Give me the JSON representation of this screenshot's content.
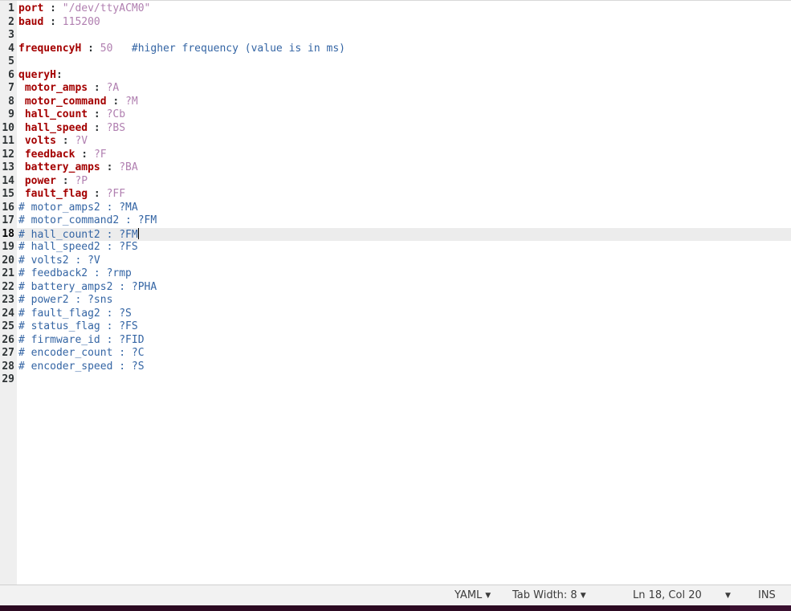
{
  "editor": {
    "current_line": 18,
    "lines": [
      {
        "n": "1",
        "segs": [
          {
            "t": "port",
            "c": "k"
          },
          {
            "t": " : ",
            "c": "p"
          },
          {
            "t": "\"/dev/ttyACM0\"",
            "c": "v"
          }
        ]
      },
      {
        "n": "2",
        "segs": [
          {
            "t": "baud",
            "c": "k"
          },
          {
            "t": " : ",
            "c": "p"
          },
          {
            "t": "115200",
            "c": "v"
          }
        ]
      },
      {
        "n": "3",
        "segs": []
      },
      {
        "n": "4",
        "segs": [
          {
            "t": "frequencyH",
            "c": "k"
          },
          {
            "t": " : ",
            "c": "p"
          },
          {
            "t": "50",
            "c": "v"
          },
          {
            "t": "   #higher frequency (value is in ms)",
            "c": "c"
          }
        ]
      },
      {
        "n": "5",
        "segs": []
      },
      {
        "n": "6",
        "segs": [
          {
            "t": "queryH",
            "c": "k"
          },
          {
            "t": ":",
            "c": "p"
          }
        ]
      },
      {
        "n": "7",
        "segs": [
          {
            "t": " ",
            "c": "p"
          },
          {
            "t": "motor_amps",
            "c": "k"
          },
          {
            "t": " : ",
            "c": "p"
          },
          {
            "t": "?A",
            "c": "v"
          }
        ]
      },
      {
        "n": "8",
        "segs": [
          {
            "t": " ",
            "c": "p"
          },
          {
            "t": "motor_command",
            "c": "k"
          },
          {
            "t": " : ",
            "c": "p"
          },
          {
            "t": "?M",
            "c": "v"
          }
        ]
      },
      {
        "n": "9",
        "segs": [
          {
            "t": " ",
            "c": "p"
          },
          {
            "t": "hall_count",
            "c": "k"
          },
          {
            "t": " : ",
            "c": "p"
          },
          {
            "t": "?Cb",
            "c": "v"
          }
        ]
      },
      {
        "n": "10",
        "segs": [
          {
            "t": " ",
            "c": "p"
          },
          {
            "t": "hall_speed",
            "c": "k"
          },
          {
            "t": " : ",
            "c": "p"
          },
          {
            "t": "?BS",
            "c": "v"
          }
        ]
      },
      {
        "n": "11",
        "segs": [
          {
            "t": " ",
            "c": "p"
          },
          {
            "t": "volts",
            "c": "k"
          },
          {
            "t": " : ",
            "c": "p"
          },
          {
            "t": "?V",
            "c": "v"
          }
        ]
      },
      {
        "n": "12",
        "segs": [
          {
            "t": " ",
            "c": "p"
          },
          {
            "t": "feedback",
            "c": "k"
          },
          {
            "t": " : ",
            "c": "p"
          },
          {
            "t": "?F",
            "c": "v"
          }
        ]
      },
      {
        "n": "13",
        "segs": [
          {
            "t": " ",
            "c": "p"
          },
          {
            "t": "battery_amps",
            "c": "k"
          },
          {
            "t": " : ",
            "c": "p"
          },
          {
            "t": "?BA",
            "c": "v"
          }
        ]
      },
      {
        "n": "14",
        "segs": [
          {
            "t": " ",
            "c": "p"
          },
          {
            "t": "power",
            "c": "k"
          },
          {
            "t": " : ",
            "c": "p"
          },
          {
            "t": "?P",
            "c": "v"
          }
        ]
      },
      {
        "n": "15",
        "segs": [
          {
            "t": " ",
            "c": "p"
          },
          {
            "t": "fault_flag",
            "c": "k"
          },
          {
            "t": " : ",
            "c": "p"
          },
          {
            "t": "?FF",
            "c": "v"
          }
        ]
      },
      {
        "n": "16",
        "segs": [
          {
            "t": "# motor_amps2 : ?MA",
            "c": "c"
          }
        ]
      },
      {
        "n": "17",
        "segs": [
          {
            "t": "# motor_command2 : ?FM",
            "c": "c"
          }
        ]
      },
      {
        "n": "18",
        "segs": [
          {
            "t": "# hall_count2 : ?FM",
            "c": "c"
          }
        ]
      },
      {
        "n": "19",
        "segs": [
          {
            "t": "# hall_speed2 : ?FS",
            "c": "c"
          }
        ]
      },
      {
        "n": "20",
        "segs": [
          {
            "t": "# volts2 : ?V",
            "c": "c"
          }
        ]
      },
      {
        "n": "21",
        "segs": [
          {
            "t": "# feedback2 : ?rmp",
            "c": "c"
          }
        ]
      },
      {
        "n": "22",
        "segs": [
          {
            "t": "# battery_amps2 : ?PHA",
            "c": "c"
          }
        ]
      },
      {
        "n": "23",
        "segs": [
          {
            "t": "# power2 : ?sns",
            "c": "c"
          }
        ]
      },
      {
        "n": "24",
        "segs": [
          {
            "t": "# fault_flag2 : ?S",
            "c": "c"
          }
        ]
      },
      {
        "n": "25",
        "segs": [
          {
            "t": "# status_flag : ?FS",
            "c": "c"
          }
        ]
      },
      {
        "n": "26",
        "segs": [
          {
            "t": "# firmware_id : ?FID",
            "c": "c"
          }
        ]
      },
      {
        "n": "27",
        "segs": [
          {
            "t": "# encoder_count : ?C",
            "c": "c"
          }
        ]
      },
      {
        "n": "28",
        "segs": [
          {
            "t": "# encoder_speed : ?S",
            "c": "c"
          }
        ]
      },
      {
        "n": "29",
        "segs": []
      }
    ]
  },
  "statusbar": {
    "language": "YAML",
    "tab_width": "Tab Width: 8",
    "cursor_pos": "Ln 18, Col 20",
    "insert_mode": "INS",
    "dropdown_glyph": "▼"
  },
  "colors": {
    "key": "#a40000",
    "value": "#b07fb0",
    "comment": "#3465a4",
    "current_line": "#ececec",
    "taskbar": "#2c0a22"
  }
}
